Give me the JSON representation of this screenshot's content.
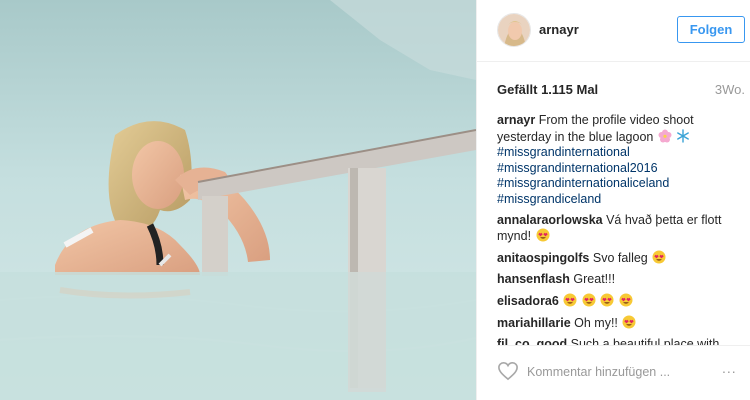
{
  "post": {
    "username": "arnayr",
    "follow_label": "Folgen",
    "likes": "Gefällt 1.115 Mal",
    "age": "3Wo."
  },
  "caption": {
    "user": "arnayr",
    "text": "From the profile video shoot yesterday in the blue lagoon",
    "emojis": [
      "blossom-icon",
      "snowflake-icon"
    ],
    "hashtags": [
      "#missgrandinternational",
      "#missgrandinternational2016",
      "#missgrandinternationaliceland",
      "#missgrandiceland"
    ]
  },
  "comments": [
    {
      "user": "annalaraorlowska",
      "text": "Vá hvað þetta er flott mynd!",
      "emojis": [
        "heart-eyes-emoji"
      ]
    },
    {
      "user": "anitaospingolfs",
      "text": "Svo falleg",
      "emojis": [
        "heart-eyes-emoji"
      ]
    },
    {
      "user": "hansenflash",
      "text": "Great!!!",
      "emojis": []
    },
    {
      "user": "elisadora6",
      "text": "",
      "emojis": [
        "heart-eyes-emoji",
        "heart-eyes-emoji",
        "heart-eyes-emoji",
        "heart-eyes-emoji"
      ]
    },
    {
      "user": "mariahillarie",
      "text": "Oh my!!",
      "emojis": [
        "heart-eyes-emoji"
      ]
    },
    {
      "user": "fil_co_good",
      "text": "Such a beautiful place with",
      "emojis": []
    }
  ],
  "footer": {
    "comment_placeholder": "Kommentar hinzufügen ...",
    "more_label": "..."
  },
  "colors": {
    "accent": "#3897f0",
    "hashtag": "#003569",
    "water": "#b9d9d9",
    "muted": "#999999"
  }
}
